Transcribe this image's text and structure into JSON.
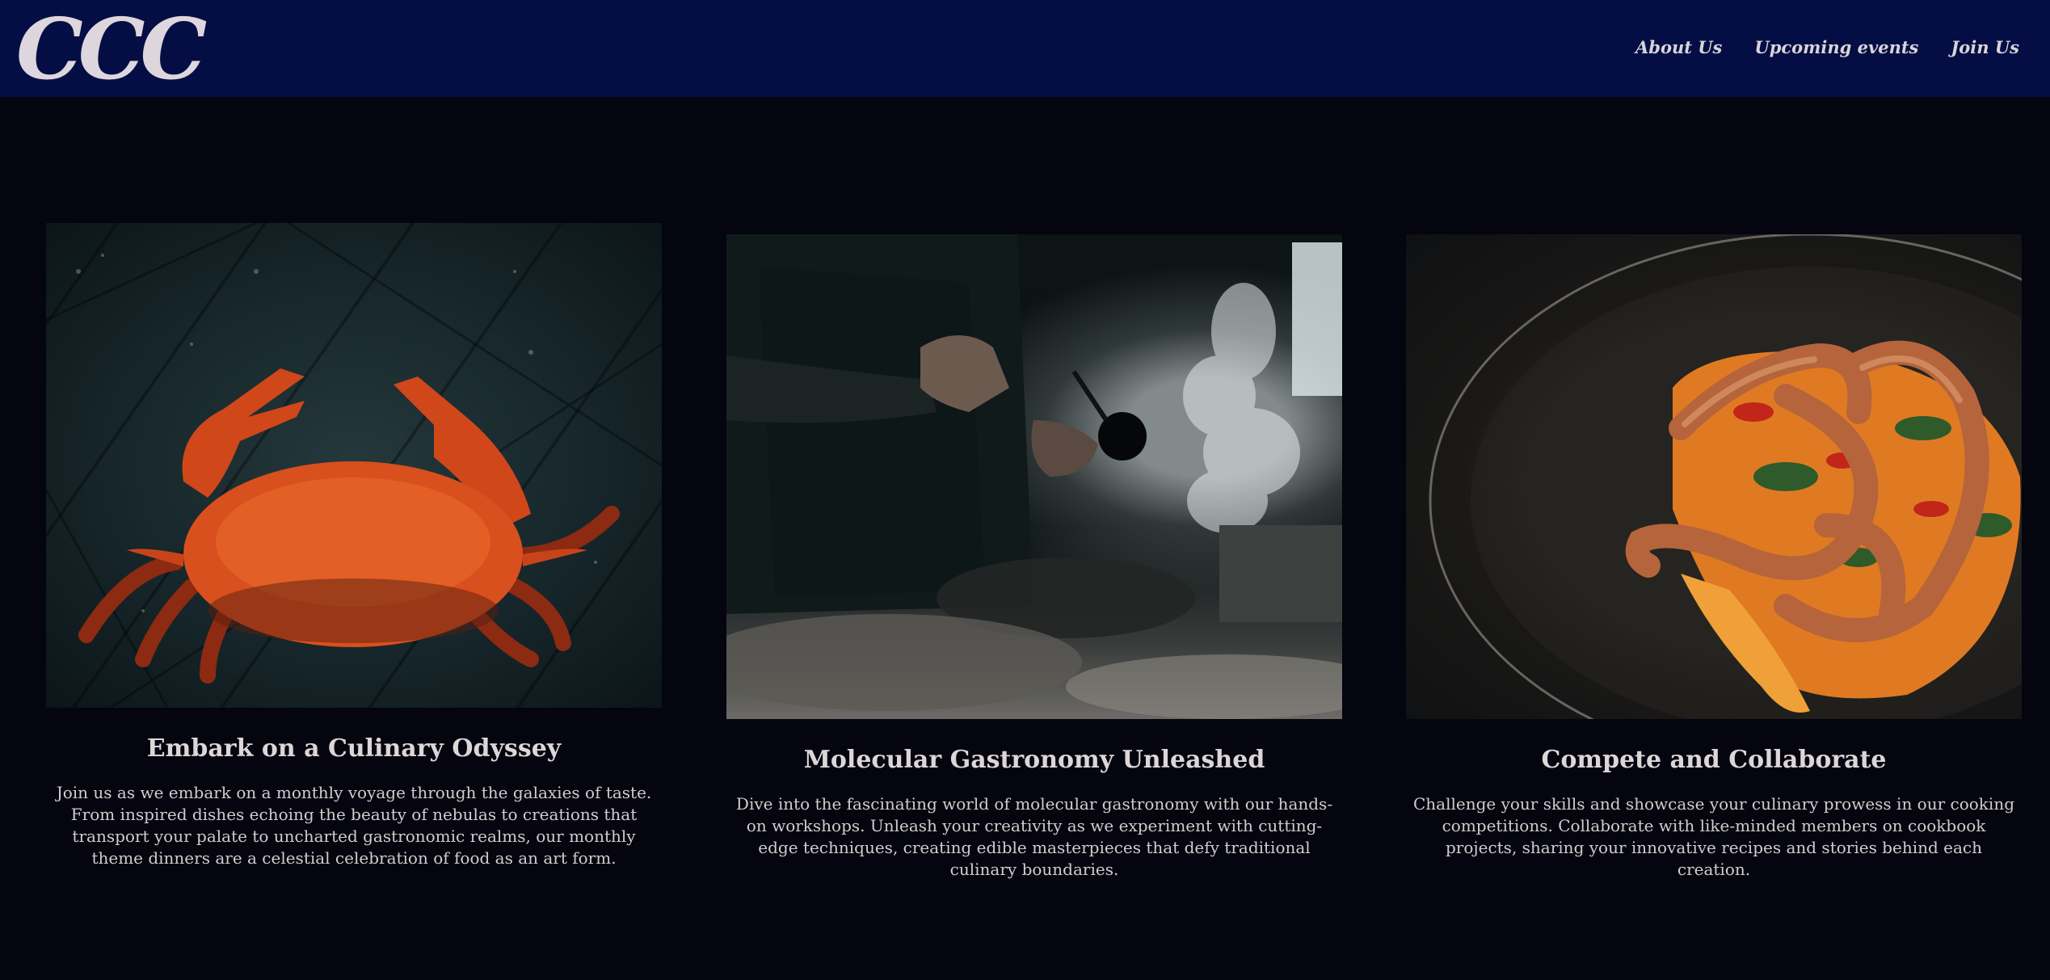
{
  "header": {
    "logo": "CCC",
    "nav": [
      {
        "label": "About Us"
      },
      {
        "label": "Upcoming events"
      },
      {
        "label": "Join Us"
      }
    ]
  },
  "cards": [
    {
      "title": "Embark on a Culinary Odyssey",
      "text": "Join us as we embark on a monthly voyage through the galaxies of taste. From inspired dishes echoing the beauty of nebulas to creations that transport your palate to uncharted gastronomic realms, our monthly theme dinners are a celestial celebration of food as an art form."
    },
    {
      "title": "Molecular Gastronomy Unleashed",
      "text": "Dive into the fascinating world of molecular gastronomy with our hands-on workshops. Unleash your creativity as we experiment with cutting-edge techniques, creating edible masterpieces that defy traditional culinary boundaries."
    },
    {
      "title": "Compete and Collaborate",
      "text": "Challenge your skills and showcase your culinary prowess in our cooking competitions. Collaborate with like-minded members on cookbook projects, sharing your innovative recipes and stories behind each creation."
    }
  ],
  "colors": {
    "header_bg": "#050e44",
    "page_bg": "#04050e",
    "text": "#d9d4d6"
  }
}
